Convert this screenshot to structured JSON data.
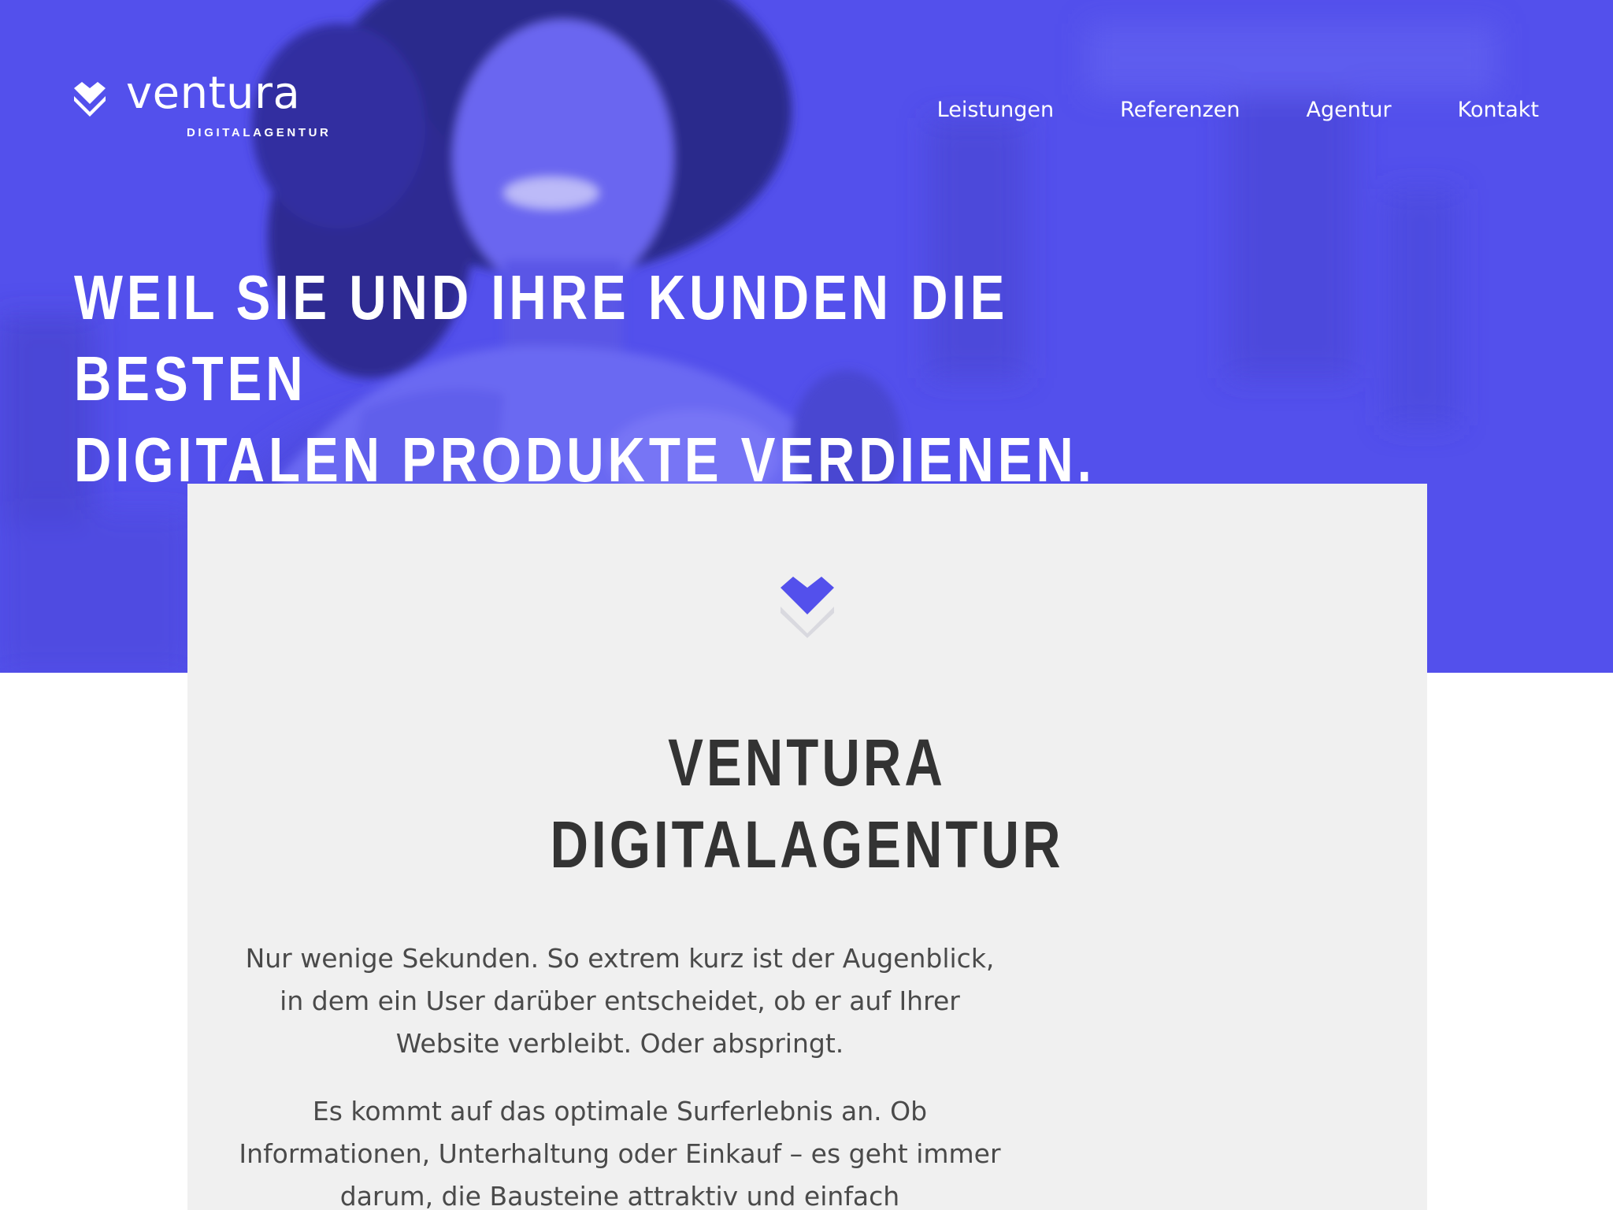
{
  "brand": {
    "name": "ventura",
    "tagline": "DIGITALAGENTUR",
    "accent_color": "#5350ec",
    "icon": "chevron-heart-icon"
  },
  "nav": {
    "items": [
      {
        "label": "Leistungen"
      },
      {
        "label": "Referenzen"
      },
      {
        "label": "Agentur"
      },
      {
        "label": "Kontakt"
      }
    ]
  },
  "hero": {
    "headline_line1": "WEIL SIE UND IHRE KUNDEN DIE BESTEN",
    "headline_line2": "DIGITALEN PRODUKTE VERDIENEN.",
    "image": "smiling-woman-with-phone-photo"
  },
  "intro": {
    "icon": "chevron-heart-icon",
    "title_line1": "VENTURA",
    "title_line2": "DIGITALAGENTUR",
    "paragraph1": "Nur wenige Sekunden. So extrem kurz ist der Augenblick, in dem ein User darüber entscheidet, ob er auf Ihrer Website verbleibt. Oder abspringt.",
    "paragraph2": "Es kommt auf das optimale Surferlebnis an. Ob Informationen, Unterhaltung oder Einkauf – es geht immer darum, die Bausteine attraktiv und einfach"
  }
}
